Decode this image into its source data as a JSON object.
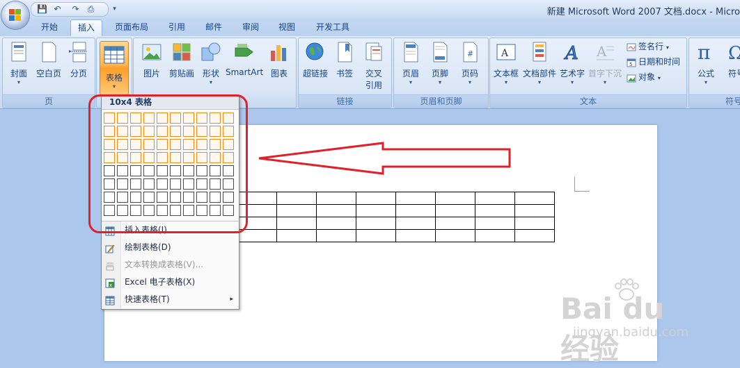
{
  "window": {
    "title": "新建 Microsoft Word 2007 文档.docx - Micro"
  },
  "quick_access": {
    "save": "💾",
    "undo": "↶",
    "redo": "↷",
    "more": "▾"
  },
  "tabs": [
    {
      "label": "开始",
      "active": false
    },
    {
      "label": "插入",
      "active": true
    },
    {
      "label": "页面布局",
      "active": false
    },
    {
      "label": "引用",
      "active": false
    },
    {
      "label": "邮件",
      "active": false
    },
    {
      "label": "审阅",
      "active": false
    },
    {
      "label": "视图",
      "active": false
    },
    {
      "label": "开发工具",
      "active": false
    }
  ],
  "ribbon": {
    "groups": {
      "pages": "页",
      "links": "链接",
      "header_footer": "页眉和页脚",
      "text": "文本",
      "symbols": "符号"
    },
    "buttons": {
      "cover": "封面",
      "blank_page": "空白页",
      "page_break": "分页",
      "table": "表格",
      "picture": "图片",
      "clipart": "剪贴画",
      "shapes": "形状",
      "smartart": "SmartArt",
      "chart": "图表",
      "hyperlink": "超链接",
      "bookmark": "书签",
      "cross_ref_1": "交叉",
      "cross_ref_2": "引用",
      "header": "页眉",
      "footer": "页脚",
      "page_number": "页码",
      "textbox": "文本框",
      "quick_parts": "文档部件",
      "wordart": "艺术字",
      "drop_cap": "首字下沉",
      "signature": "签名行",
      "datetime": "日期和时间",
      "object": "对象",
      "equation": "公式",
      "symbol": "符号"
    }
  },
  "table_menu": {
    "title": "10x4 表格",
    "grid_cols": 10,
    "grid_rows": 8,
    "selected_cols": 10,
    "selected_rows": 4,
    "items": [
      {
        "label": "插入表格(I)...",
        "disabled": false
      },
      {
        "label": "绘制表格(D)",
        "disabled": false
      },
      {
        "label": "文本转换成表格(V)...",
        "disabled": true
      },
      {
        "label": "Excel 电子表格(X)",
        "disabled": false
      },
      {
        "label": "快速表格(T)",
        "disabled": false,
        "submenu": "▸"
      }
    ]
  },
  "watermark": {
    "main": "Bai du 经验",
    "sub": "jingyan.baidu.com"
  },
  "colors": {
    "annotation_red": "#e0202a",
    "highlight_orange": "#f08c19"
  }
}
